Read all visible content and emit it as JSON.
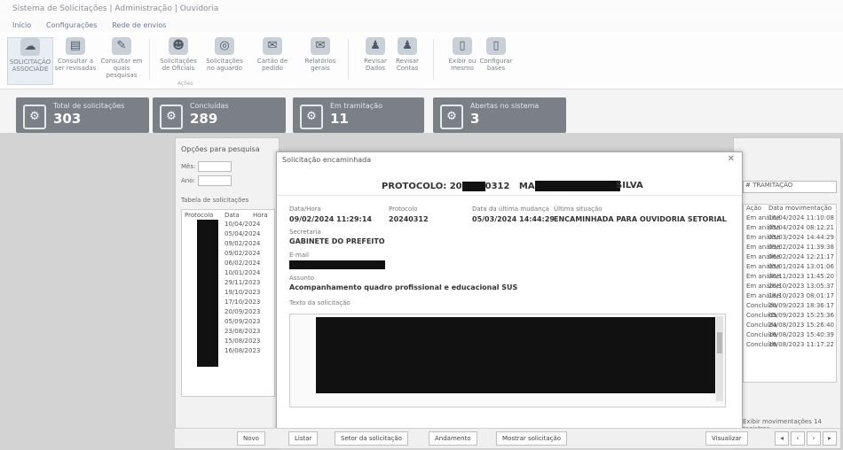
{
  "window": {
    "title": "Sistema de Solicitações | Administração | Ouvidoria"
  },
  "menu": [
    "Início",
    "Configurações",
    "Rede de envios"
  ],
  "ribbon": {
    "buttons": [
      {
        "label": "SOLICITAÇÃO ASSOCIADE",
        "icon": "☁"
      },
      {
        "label": "Consultar a ser revisadas",
        "icon": "▤"
      },
      {
        "label": "Consultar em quais pesquisas",
        "icon": "✎"
      },
      {
        "label": "Solicitações de Oficiais",
        "icon": "☻"
      },
      {
        "label": "Solicitações no aguardo",
        "icon": "◎"
      },
      {
        "label": "Cartão de pedido",
        "icon": "✉"
      },
      {
        "label": "Relatórios gerais",
        "icon": "✉"
      },
      {
        "label": "Revisar Dados",
        "icon": "♟"
      },
      {
        "label": "Revisar Contas",
        "icon": "♟"
      },
      {
        "label": "Exibir ou mesmo",
        "icon": "▯"
      },
      {
        "label": "Configurar bases",
        "icon": "▯"
      }
    ],
    "group_label": "Ações"
  },
  "tiles": [
    {
      "label": "Total de solicitações",
      "value": "303",
      "icon": "⚙"
    },
    {
      "label": "Concluídas",
      "value": "289",
      "icon": "⚙"
    },
    {
      "label": "Em tramitação",
      "value": "11",
      "icon": "⚙"
    },
    {
      "label": "Abertas no sistema",
      "value": "3",
      "icon": "⚙"
    }
  ],
  "left_panel": {
    "title": "Opções para pesquisa",
    "filters": [
      {
        "label": "Mês:"
      },
      {
        "label": "Ano:"
      }
    ],
    "list_title": "Tabela de solicitações",
    "columns": [
      "Protocolo",
      "Data",
      "Hora"
    ],
    "rows": [
      {
        "date": "10/04/2024"
      },
      {
        "date": "05/04/2024"
      },
      {
        "date": "09/02/2024"
      },
      {
        "date": "09/02/2024"
      },
      {
        "date": "06/02/2024"
      },
      {
        "date": "10/01/2024"
      },
      {
        "date": "29/11/2023"
      },
      {
        "date": "19/10/2023"
      },
      {
        "date": "17/10/2023"
      },
      {
        "date": "20/09/2023"
      },
      {
        "date": "05/09/2023"
      },
      {
        "date": "23/08/2023"
      },
      {
        "date": "15/08/2023"
      },
      {
        "date": "16/08/2023"
      }
    ]
  },
  "modal": {
    "title": "Solicitação encaminhada",
    "protocolo_label": "PROTOCOLO: 20",
    "protocolo_suffix": "0312",
    "name_label": "MA",
    "name_suffix": "SILVA",
    "fields": [
      {
        "label": "Data/Hora",
        "value": "09/02/2024 11:29:14"
      },
      {
        "label": "Protocolo",
        "value": "20240312"
      },
      {
        "label": "Data da última mudança",
        "value": "05/03/2024 14:44:29"
      },
      {
        "label": "Última situação",
        "value": "ENCAMINHADA PARA OUVIDORIA SETORIAL"
      }
    ],
    "secretaria_label": "Secretaria",
    "secretaria_value": "GABINETE DO PREFEITO",
    "email_label": "E-mail",
    "assunto_label": "Assunto",
    "assunto_value": "Acompanhamento quadro profissional e educacional SUS",
    "texto_label": "Texto da solicitação"
  },
  "right_panel": {
    "header": "# TRAMITAÇÃO",
    "columns": [
      "Ação",
      "Data movimentação"
    ],
    "rows": [
      {
        "a": "Em análise",
        "d": "10/04/2024 11:10:08"
      },
      {
        "a": "Em análise",
        "d": "05/04/2024 08:12:21"
      },
      {
        "a": "Em análise",
        "d": "05/03/2024 14:44:29"
      },
      {
        "a": "Em análise",
        "d": "09/02/2024 11:39:38"
      },
      {
        "a": "Em análise",
        "d": "06/02/2024 12:21:17"
      },
      {
        "a": "Em análise",
        "d": "05/01/2024 13:01:06"
      },
      {
        "a": "Em análise",
        "d": "30/11/2023 11:45:20"
      },
      {
        "a": "Em análise",
        "d": "20/10/2023 13:05:37"
      },
      {
        "a": "Em análise",
        "d": "18/10/2023 08:01:17"
      },
      {
        "a": "Concluída",
        "d": "20/09/2023 18:36:17"
      },
      {
        "a": "Concluída",
        "d": "05/09/2023 15:25:36"
      },
      {
        "a": "Concluída",
        "d": "24/08/2023 15:26:40"
      },
      {
        "a": "Concluída",
        "d": "16/08/2023 15:40:39"
      },
      {
        "a": "Concluída",
        "d": "16/08/2023 11:17:22"
      }
    ],
    "footer": "Exibir movimentações 14 registros"
  },
  "bottom_bar": {
    "novo": "Novo",
    "listar": "Listar",
    "setor": "Setor da solicitação",
    "andamento": "Andamento",
    "mostrar": "Mostrar solicitação",
    "visualizar": "Visualizar"
  }
}
